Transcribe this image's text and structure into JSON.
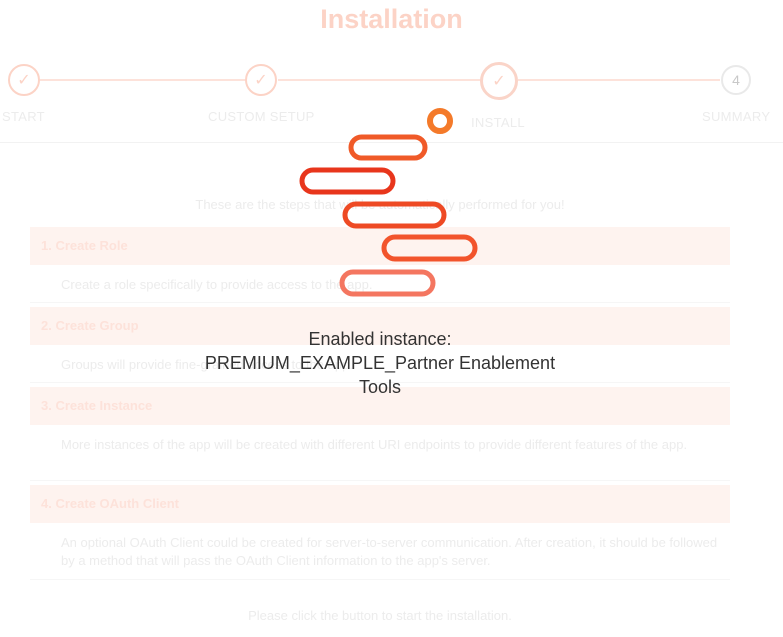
{
  "page": {
    "title": "Installation",
    "steps": [
      {
        "label": "START",
        "state": "done",
        "icon": "check-icon"
      },
      {
        "label": "CUSTOM SETUP",
        "state": "done",
        "icon": "check-icon"
      },
      {
        "label": "INSTALL",
        "state": "active",
        "icon": "check-icon"
      },
      {
        "label": "SUMMARY",
        "state": "pending",
        "number": "4"
      }
    ],
    "intro": "These are the steps that will be automatically performed for you!",
    "sections": [
      {
        "heading": "1. Create Role",
        "body": "Create a role specifically to provide access to the app."
      },
      {
        "heading": "2. Create Group",
        "body": "Groups will provide fine-grained access to the app."
      },
      {
        "heading": "3. Create Instance",
        "body": "More instances of the app will be created with different URI endpoints to provide different features of the app."
      },
      {
        "heading": "4. Create OAuth Client",
        "body": "An optional OAuth Client could be created for server-to-server communication. After creation, it should be followed by a method that will pass the OAuth Client information to the app's server."
      }
    ],
    "footer": "Please click the button to start the installation."
  },
  "overlay": {
    "status_line1": "Enabled instance:",
    "status_line2": "PREMIUM_EXAMPLE_Partner Enablement",
    "status_line3": "Tools",
    "spinner_icon": "loading-spinner-icon"
  },
  "colors": {
    "accent": "#f04e23",
    "accent_light": "#fcd3c6",
    "section_bg": "#fef3ef",
    "text_faded": "#ececec",
    "status_text": "#333333"
  }
}
